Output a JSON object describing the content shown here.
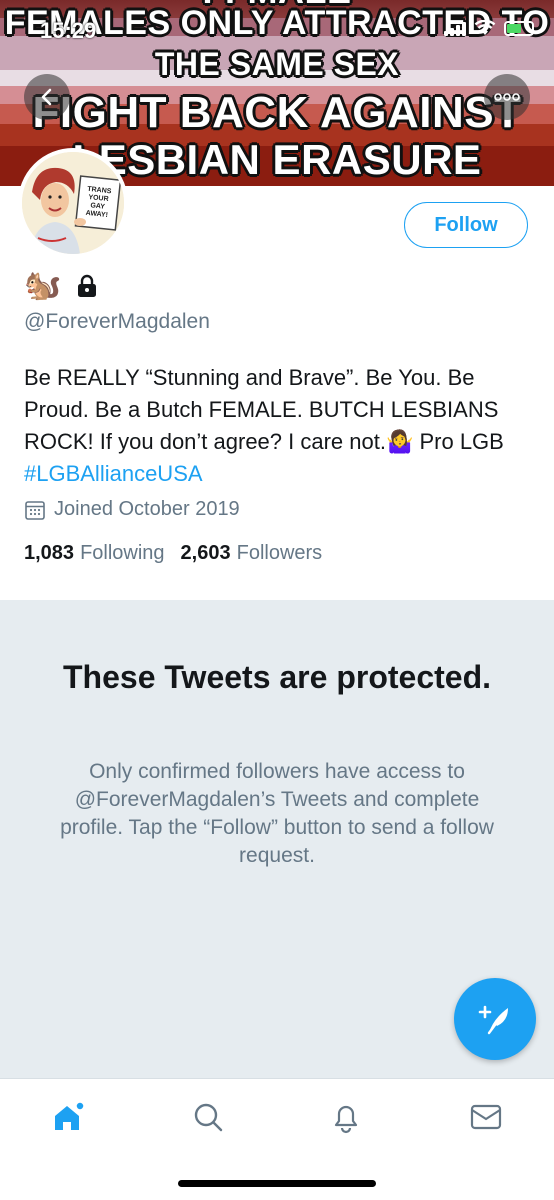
{
  "status_bar": {
    "time": "15:29"
  },
  "banner": {
    "lines": [
      "FFMALE",
      "FEMALES ONLY ATTRACTED TO",
      "THE SAME SEX",
      "FIGHT BACK AGAINST",
      "LESBIAN ERASURE"
    ]
  },
  "avatar": {
    "sign_text": "TRANS YOUR GAY AWAY!"
  },
  "profile": {
    "follow_label": "Follow",
    "name_emoji": "🐿️",
    "handle": "@ForeverMagdalen",
    "bio_text": "Be REALLY “Stunning and Brave”. Be You. Be Proud. Be a Butch FEMALE. BUTCH LESBIANS ROCK! If you don’t agree? I care not.🤷‍♀️ Pro LGB ",
    "bio_hashtag": "#LGBAllianceUSA",
    "joined": "Joined October 2019",
    "following_count": "1,083",
    "following_label": "Following",
    "followers_count": "2,603",
    "followers_label": "Followers"
  },
  "protected": {
    "title": "These Tweets are protected.",
    "body": "Only confirmed followers have access to @ForeverMagdalen’s Tweets and complete profile. Tap the “Follow” button to send a follow request."
  },
  "tabs": [
    "home-icon",
    "search-icon",
    "notifications-icon",
    "messages-icon"
  ],
  "colors": {
    "accent": "#1da1f2",
    "secondary_text": "#657786",
    "protected_bg": "#e6ecf0"
  }
}
